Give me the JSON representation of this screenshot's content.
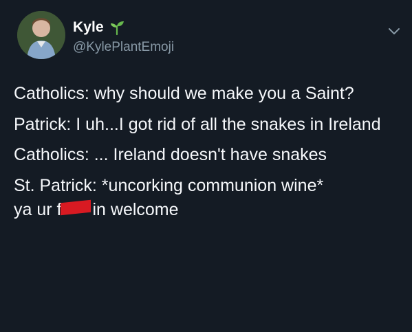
{
  "header": {
    "display_name": "Kyle",
    "handle": "@KylePlantEmoji",
    "icon_avatar": "avatar",
    "icon_plant": "seedling-icon",
    "icon_menu": "chevron-down-icon"
  },
  "tweet": {
    "line_1": "Catholics: why should we make you a Saint?",
    "line_2": "Patrick: I uh...I got rid of all the snakes in Ireland",
    "line_3": "Catholics: ... Ireland doesn't have snakes",
    "line_4a": "St. Patrick: *uncorking communion wine*",
    "line_4b_prefix": "ya ur f",
    "line_4b_suffix": "in welcome"
  },
  "colors": {
    "background": "#141b24",
    "text": "#f5f7fa",
    "muted": "#8899a6",
    "censor": "#d81a22"
  }
}
